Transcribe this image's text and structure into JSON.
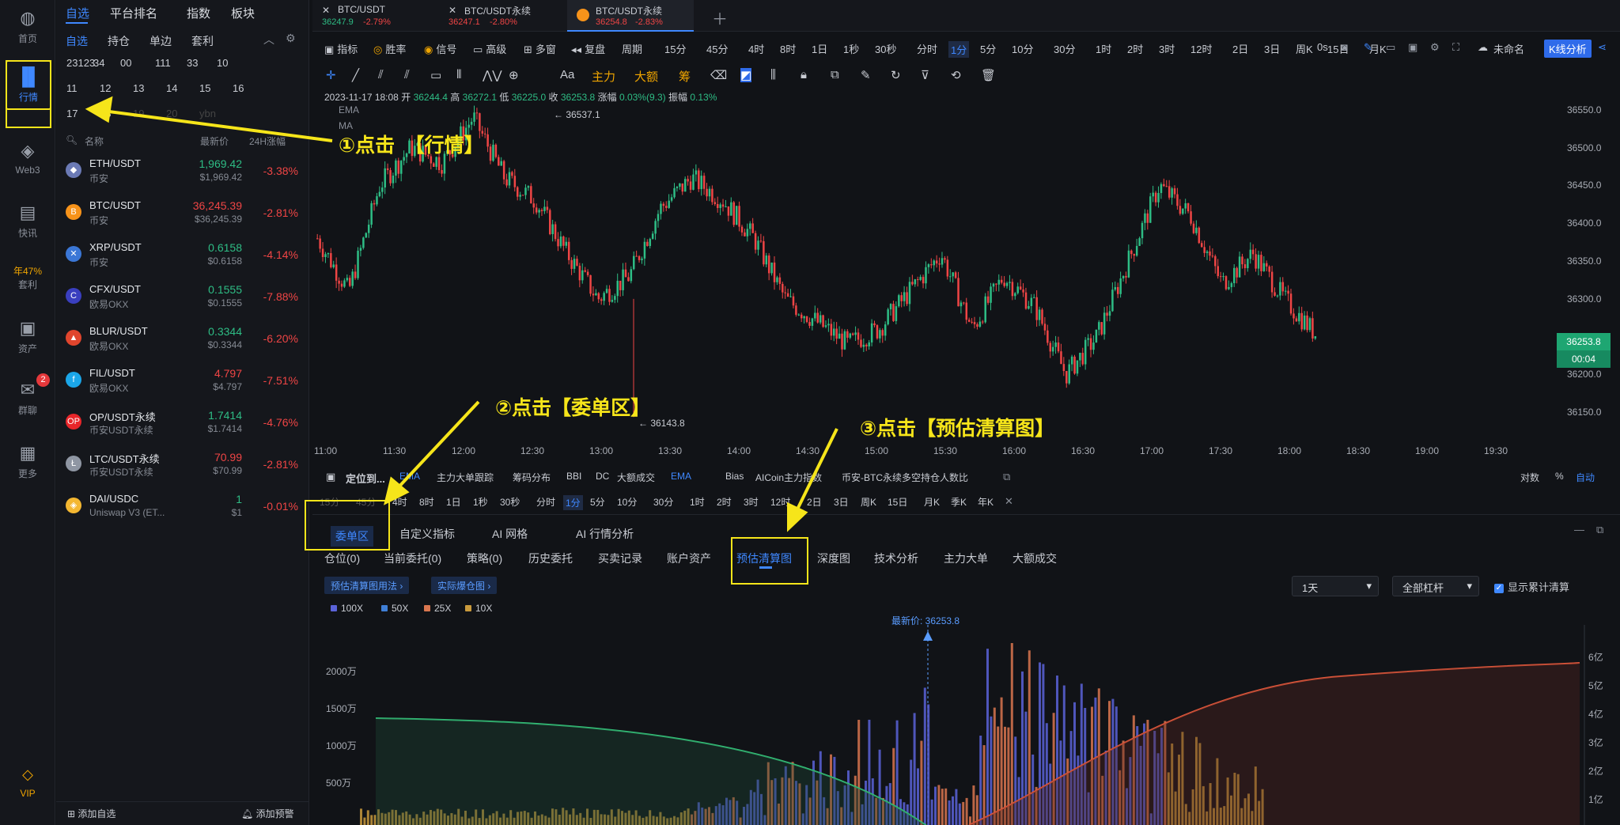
{
  "rail": {
    "items": [
      {
        "label": "首页",
        "icon": "home-icon"
      },
      {
        "label": "行情",
        "icon": "market-chart-icon"
      },
      {
        "label": "Web3",
        "icon": "web3-icon"
      },
      {
        "label": "快讯",
        "icon": "news-icon"
      },
      {
        "label": "年47%",
        "label2": "套利",
        "icon": "arbitrage-icon"
      },
      {
        "label": "资产",
        "icon": "wallet-icon"
      },
      {
        "label": "群聊",
        "icon": "chat-icon",
        "badge": "2"
      },
      {
        "label": "更多",
        "icon": "more-grid-icon"
      },
      {
        "label": "VIP",
        "icon": "vip-diamond-icon"
      }
    ]
  },
  "watch": {
    "tabs": [
      "自选",
      "平台排名",
      "指数",
      "板块"
    ],
    "subtabs": [
      "自选",
      "持仓",
      "单边",
      "套利"
    ],
    "groups": [
      "23123",
      "34",
      "00",
      "111",
      "33",
      "10",
      "11",
      "12",
      "13",
      "14",
      "15",
      "16",
      "17",
      "18",
      "19",
      "20",
      "ybn"
    ],
    "headers": {
      "name": "名称",
      "price": "最新价",
      "change": "24H涨幅"
    },
    "rows": [
      {
        "symbol": "ETH/USDT",
        "exchange": "币安",
        "price": "1,969.42",
        "price2": "$1,969.42",
        "change": "-3.38%",
        "dir": "up",
        "coin": "#6b7ab5",
        "glyph": "◆"
      },
      {
        "symbol": "BTC/USDT",
        "exchange": "币安",
        "price": "36,245.39",
        "price2": "$36,245.39",
        "change": "-2.81%",
        "dir": "dn",
        "coin": "#f7931a",
        "glyph": "B"
      },
      {
        "symbol": "XRP/USDT",
        "exchange": "币安",
        "price": "0.6158",
        "price2": "$0.6158",
        "change": "-4.14%",
        "dir": "up",
        "coin": "#3b77d6",
        "glyph": "✕"
      },
      {
        "symbol": "CFX/USDT",
        "exchange": "欧易OKX",
        "price": "0.1555",
        "price2": "$0.1555",
        "change": "-7.88%",
        "dir": "up",
        "coin": "#3a3fbf",
        "glyph": "C"
      },
      {
        "symbol": "BLUR/USDT",
        "exchange": "欧易OKX",
        "price": "0.3344",
        "price2": "$0.3344",
        "change": "-6.20%",
        "dir": "up",
        "coin": "#e0452d",
        "glyph": "▲"
      },
      {
        "symbol": "FIL/USDT",
        "exchange": "欧易OKX",
        "price": "4.797",
        "price2": "$4.797",
        "change": "-7.51%",
        "dir": "dn",
        "coin": "#1ba6e8",
        "glyph": "f"
      },
      {
        "symbol": "OP/USDT永续",
        "exchange": "币安USDT永续",
        "price": "1.7414",
        "price2": "$1.7414",
        "change": "-4.76%",
        "dir": "up",
        "coin": "#e8262a",
        "glyph": "OP"
      },
      {
        "symbol": "LTC/USDT永续",
        "exchange": "币安USDT永续",
        "price": "70.99",
        "price2": "$70.99",
        "change": "-2.81%",
        "dir": "dn",
        "coin": "#8f96a3",
        "glyph": "Ł"
      },
      {
        "symbol": "DAI/USDC",
        "exchange": "Uniswap V3 (ET...",
        "price": "1",
        "price2": "$1",
        "change": "-0.01%",
        "dir": "up",
        "coin": "#f4b731",
        "glyph": "◈"
      }
    ],
    "add_watch": "添加自选",
    "add_alert": "添加预警"
  },
  "chart_tabs": [
    {
      "name": "BTC/USDT",
      "price": "36247.9",
      "change": "-2.79%"
    },
    {
      "name": "BTC/USDT永续",
      "price": "36247.1",
      "change": "-2.80%"
    },
    {
      "name": "BTC/USDT永续",
      "price": "36254.8",
      "change": "-2.83%"
    }
  ],
  "toolbar1": {
    "items": [
      "指标",
      "胜率",
      "信号",
      "高级",
      "多窗",
      "复盘",
      "周期"
    ],
    "periods": [
      "15分",
      "45分",
      "4时",
      "8时",
      "1日",
      "1秒",
      "30秒",
      "分时",
      "1分",
      "5分",
      "10分",
      "30分",
      "1时",
      "2时",
      "3时",
      "12时",
      "2日",
      "3日",
      "周K",
      "15日",
      "月K"
    ],
    "active_period": "1分",
    "right": {
      "latency": "0s",
      "workspace": "未命名",
      "kline": "K线分析"
    }
  },
  "toolbar2": {
    "items": [
      "Aa",
      "主力",
      "大额",
      "筹"
    ]
  },
  "ohlc": {
    "datetime": "2023-11-17 18:08",
    "o_label": "开",
    "o": "36244.4",
    "h_label": "高",
    "h": "36272.1",
    "l_label": "低",
    "l": "36225.0",
    "c_label": "收",
    "c": "36253.8",
    "chg_label": "涨幅",
    "chg": "0.03%(9.3)",
    "amp_label": "振幅",
    "amp": "0.13%",
    "ema": "EMA",
    "ma": "MA"
  },
  "chart_data": {
    "type": "candlestick",
    "ylim": [
      36120,
      36580
    ],
    "y_ticks": [
      "36550.0",
      "36500.0",
      "36450.0",
      "36400.0",
      "36350.0",
      "36300.0",
      "36250.0",
      "36200.0",
      "36150.0"
    ],
    "x_ticks": [
      "11:00",
      "11:30",
      "12:00",
      "12:30",
      "13:00",
      "13:30",
      "14:00",
      "14:30",
      "15:00",
      "15:30",
      "16:00",
      "16:30",
      "17:00",
      "17:30",
      "18:00",
      "18:30",
      "19:00",
      "19:30"
    ],
    "high_label": "36537.1",
    "low_label": "36143.8",
    "last_price": "36253.8",
    "countdown": "00:04",
    "close_path": [
      36380,
      36310,
      36450,
      36500,
      36480,
      36540,
      36460,
      36430,
      36360,
      36300,
      36330,
      36420,
      36460,
      36430,
      36380,
      36300,
      36270,
      36240,
      36260,
      36310,
      36360,
      36260,
      36330,
      36290,
      36200,
      36250,
      36350,
      36450,
      36410,
      36320,
      36360,
      36300,
      36254
    ]
  },
  "indicator_bar": {
    "locate": "定位到...",
    "items": [
      "EMA",
      "主力大单跟踪",
      "筹码分布",
      "BBI",
      "DC",
      "大额成交",
      "EMA",
      "Bias",
      "AICoin主力指数",
      "币安-BTC永续多空持仓人数比"
    ],
    "right": [
      "对数",
      "%",
      "自动"
    ]
  },
  "periods2": [
    "15分",
    "45分",
    "4时",
    "8时",
    "1日",
    "1秒",
    "30秒",
    "分时",
    "1分",
    "5分",
    "10分",
    "30分",
    "1时",
    "2时",
    "3时",
    "12时",
    "2日",
    "3日",
    "周K",
    "15日",
    "月K",
    "季K",
    "年K"
  ],
  "bottom": {
    "tabs": [
      "委单区",
      "自定义指标",
      "AI 网格",
      "AI 行情分析"
    ],
    "subtabs": [
      "仓位(0)",
      "当前委托(0)",
      "策略(0)",
      "历史委托",
      "买卖记录",
      "账户资产",
      "预估清算图",
      "深度图",
      "技术分析",
      "主力大单",
      "大额成交"
    ],
    "pill1": "预估清算图用法",
    "pill2": "实际爆仓图",
    "range": "1天",
    "leverage": "全部杠杆",
    "show_cum": "显示累计清算",
    "legend": [
      {
        "name": "100X",
        "color": "#5b63d8"
      },
      {
        "name": "50X",
        "color": "#3f7fd6"
      },
      {
        "name": "25X",
        "color": "#d9764f"
      },
      {
        "name": "10X",
        "color": "#c99a3c"
      }
    ],
    "latest_price": "最新价: 36253.8",
    "y_left": [
      "2000万",
      "1500万",
      "1000万",
      "500万"
    ],
    "y_right": [
      "6亿",
      "5亿",
      "4亿",
      "3亿",
      "2亿",
      "1亿"
    ]
  },
  "callouts": {
    "c1": "①点击　【行情】",
    "c2": "②点击【委单区】",
    "c3": "③点击【预估清算图】"
  }
}
